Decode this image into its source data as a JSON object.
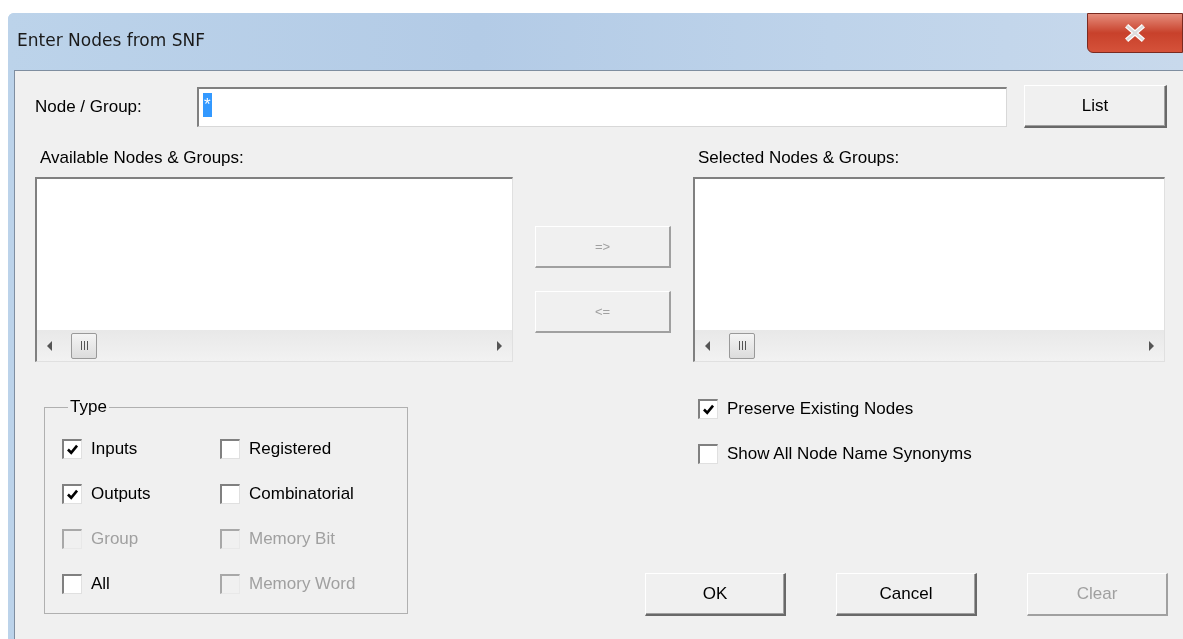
{
  "window": {
    "title": "Enter Nodes from SNF"
  },
  "node_group": {
    "label": "Node / Group:",
    "value": "*",
    "value_selected": true
  },
  "list_button": {
    "label": "List",
    "disabled": false
  },
  "available": {
    "label": "Available Nodes & Groups:"
  },
  "selected_list": {
    "label": "Selected Nodes & Groups:"
  },
  "move_buttons": [
    {
      "label": "=>",
      "disabled": true
    },
    {
      "label": "<=",
      "disabled": true
    }
  ],
  "type_group": {
    "label": "Type",
    "options": [
      {
        "label": "Inputs",
        "checked": true,
        "disabled": false
      },
      {
        "label": "Registered",
        "checked": false,
        "disabled": false
      },
      {
        "label": "Outputs",
        "checked": true,
        "disabled": false
      },
      {
        "label": "Combinatorial",
        "checked": false,
        "disabled": false
      },
      {
        "label": "Group",
        "checked": false,
        "disabled": true
      },
      {
        "label": "Memory Bit",
        "checked": false,
        "disabled": true
      },
      {
        "label": "All",
        "checked": false,
        "disabled": false
      },
      {
        "label": "Memory Word",
        "checked": false,
        "disabled": true
      }
    ]
  },
  "options": [
    {
      "label": "Preserve Existing Nodes",
      "checked": true,
      "disabled": false
    },
    {
      "label": "Show All Node Name Synonyms",
      "checked": false,
      "disabled": false
    }
  ],
  "buttons": [
    {
      "label": "OK",
      "disabled": false
    },
    {
      "label": "Cancel",
      "disabled": false
    },
    {
      "label": "Clear",
      "disabled": true
    }
  ]
}
